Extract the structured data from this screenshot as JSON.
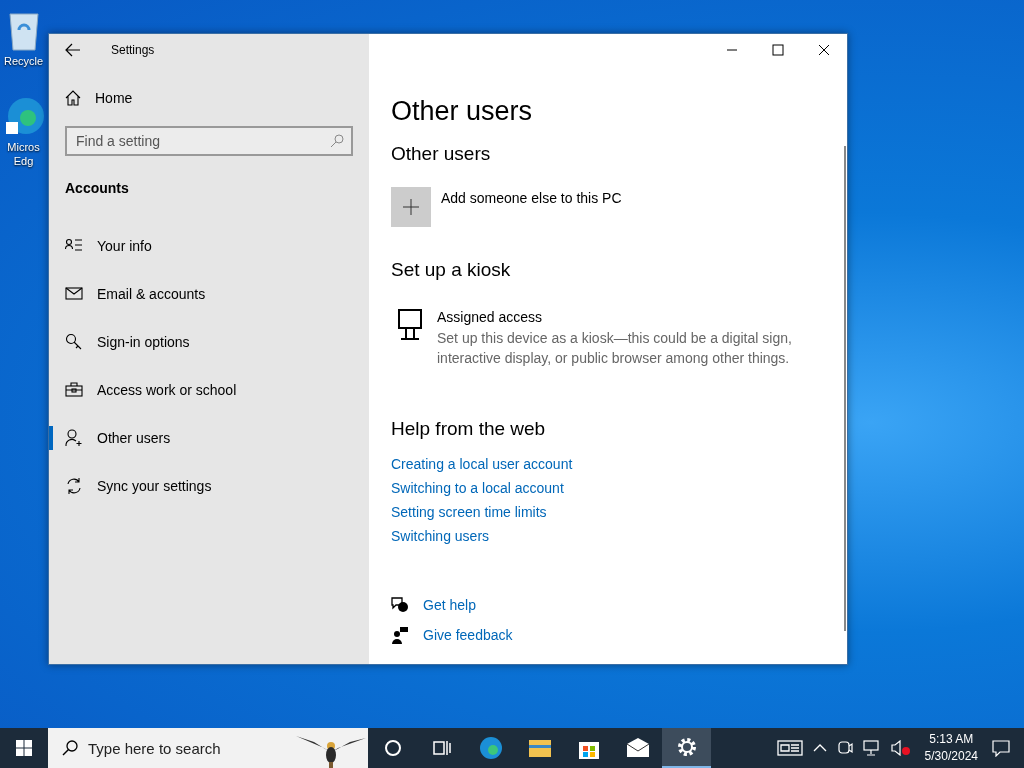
{
  "desktop_icons": [
    {
      "kind": "recycle",
      "lines": [
        "Recycle"
      ]
    },
    {
      "kind": "edge",
      "lines": [
        "Micros",
        "Edg"
      ]
    }
  ],
  "window": {
    "title": "Settings"
  },
  "sidebar": {
    "home": "Home",
    "search": {
      "placeholder": "Find a setting"
    },
    "section": "Accounts",
    "items": [
      {
        "label": "Your info",
        "kind": "info",
        "selected": false
      },
      {
        "label": "Email & accounts",
        "kind": "mail",
        "selected": false
      },
      {
        "label": "Sign-in options",
        "kind": "key",
        "selected": false
      },
      {
        "label": "Access work or school",
        "kind": "briefcase",
        "selected": false
      },
      {
        "label": "Other users",
        "kind": "person",
        "selected": true
      },
      {
        "label": "Sync your settings",
        "kind": "sync",
        "selected": false
      }
    ]
  },
  "main": {
    "title": "Other users",
    "other_users": {
      "heading": "Other users",
      "add": "Add someone else to this PC"
    },
    "kiosk": {
      "heading": "Set up a kiosk",
      "name": "Assigned access",
      "description": "Set up this device as a kiosk—this could be a digital sign, interactive display, or public browser among other things."
    },
    "help": {
      "heading": "Help from the web",
      "links": [
        "Creating a local user account",
        "Switching to a local account",
        "Setting screen time limits",
        "Switching users"
      ]
    },
    "footer_links": [
      {
        "kind": "help",
        "label": "Get help"
      },
      {
        "kind": "feedback",
        "label": "Give feedback"
      }
    ]
  },
  "taskbar": {
    "search": {
      "placeholder": "Type here to search"
    },
    "apps": [
      {
        "kind": "cortana",
        "selected": false
      },
      {
        "kind": "taskview",
        "selected": false
      },
      {
        "kind": "edge",
        "selected": false
      },
      {
        "kind": "explorer",
        "selected": false
      },
      {
        "kind": "store",
        "selected": false
      },
      {
        "kind": "mail",
        "selected": false
      },
      {
        "kind": "settings",
        "selected": true
      }
    ],
    "time": "5:13 AM",
    "date": "5/30/2024"
  }
}
